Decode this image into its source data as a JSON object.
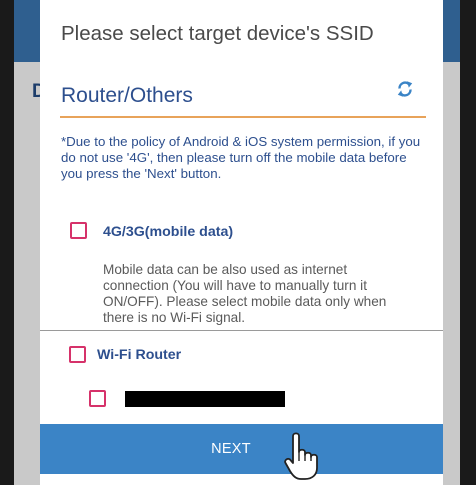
{
  "dialog": {
    "title": "Please select target device's SSID",
    "group_title": "Router/Others",
    "refresh_icon": "refresh-icon",
    "note": "*Due to the policy of Android & iOS system permission, if you do not use '4G', then please turn off the mobile data before you press the 'Next' button.",
    "options": [
      {
        "label": "4G/3G(mobile data)",
        "checked": false,
        "description": "Mobile data can be also used as internet connection (You will have to manually turn it ON/OFF). Please select mobile data only when there is no Wi-Fi signal."
      },
      {
        "label": "Wi-Fi Router",
        "checked": false
      }
    ],
    "redacted_network": {
      "checked": false
    },
    "next_button": {
      "label": "NEXT"
    }
  },
  "background": {
    "letter": "D"
  },
  "colors": {
    "accent_blue": "#2d4f8e",
    "button_blue": "#3b84c6",
    "checkbox_pink": "#d6326a",
    "underline_orange": "#e8a35a"
  }
}
